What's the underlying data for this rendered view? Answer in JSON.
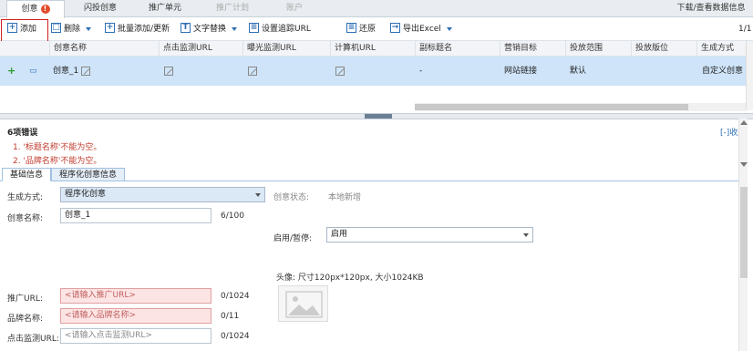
{
  "tabs": {
    "creative": "创意",
    "flash": "闪投创意",
    "unit": "推广单元",
    "plan": "推广计划",
    "account": "账户",
    "download": "下载/查看数据信息",
    "error_mark": "!"
  },
  "toolbar": {
    "add": "添加",
    "delete": "删除",
    "batch": "批量添加/更新",
    "replace": "文字替换",
    "tracking": "设置追踪URL",
    "restore": "还原",
    "export": "导出Excel",
    "page": "1/1"
  },
  "table": {
    "headers": [
      "创意名称",
      "点击监测URL",
      "曝光监测URL",
      "计算机URL",
      "副标题名",
      "营销目标",
      "投放范围",
      "投放版位",
      "生成方式"
    ],
    "row": {
      "name": "创意_1",
      "subtitle": "-",
      "target": "网站链接",
      "range": "默认",
      "gen": "自定义创意"
    }
  },
  "errors": {
    "title": "6项错误",
    "collapse": "[-]收起",
    "items": [
      "1. '标题名称'不能为空。",
      "2. '品牌名称'不能为空。"
    ]
  },
  "subtabs": {
    "basic": "基础信息",
    "programmatic": "程序化创意信息"
  },
  "form": {
    "gen_label": "生成方式:",
    "gen_value": "程序化创意",
    "status_label": "创意状态:",
    "status_value": "本地新增",
    "name_label": "创意名称:",
    "name_value": "创意_1",
    "name_count": "6/100",
    "enable_label": "启用/暂停:",
    "enable_value": "启用",
    "avatar_label": "头像: 尺寸120px*120px, 大小1024KB",
    "url_label": "推广URL:",
    "url_placeholder": "<请输入推广URL>",
    "url_count": "0/1024",
    "brand_label": "品牌名称:",
    "brand_placeholder": "<请输入品牌名称>",
    "brand_count": "0/11",
    "click_label": "点击监测URL:",
    "click_placeholder": "<请输入点击监测URL>",
    "click_count": "0/1024"
  }
}
